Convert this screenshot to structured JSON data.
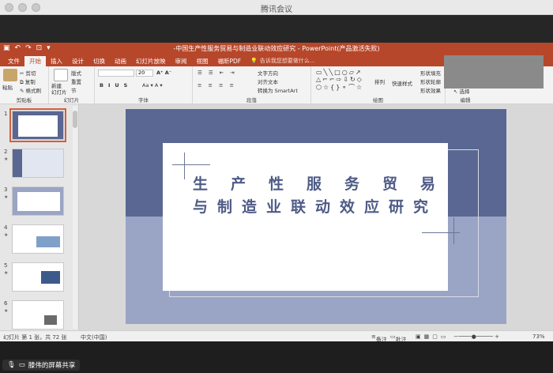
{
  "meeting": {
    "window_title": "腾讯会议",
    "share_label": "滕伟的屏幕共享"
  },
  "ppt": {
    "doc_title": "-中国生产性服务贸易与制造业联动效应研究 - PowerPoint(产品激活失败)",
    "tabs": [
      "文件",
      "开始",
      "插入",
      "设计",
      "切换",
      "动画",
      "幻灯片放映",
      "审阅",
      "视图",
      "福昕PDF"
    ],
    "active_tab": "开始",
    "tell_me": "告诉我您想要做什么...",
    "ribbon": {
      "paste": "粘贴",
      "cut": "剪切",
      "copy": "复制",
      "format_painter": "格式刷",
      "new_slide": "新建\n幻灯片",
      "layout": "版式",
      "reset": "重置",
      "section": "节",
      "font_size": "20",
      "text_direction": "文字方向",
      "align_text": "对齐文本",
      "convert_smartart": "转换为 SmartArt",
      "arrange": "排列",
      "quick_styles": "快速样式",
      "shape_fill": "形状填充",
      "shape_outline": "形状轮廓",
      "shape_effects": "形状效果",
      "select": "选择",
      "groups": {
        "clipboard": "剪贴板",
        "slides": "幻灯片",
        "font": "字体",
        "paragraph": "段落",
        "drawing": "绘图",
        "editing": "编辑"
      }
    },
    "thumb_numbers": [
      "1",
      "2",
      "3",
      "4",
      "5",
      "6"
    ],
    "slide": {
      "line1": "生产性服务贸易",
      "line2": "与制造业联动效应研究"
    },
    "status": {
      "slide_counter": "幻灯片 第 1 张，共 72 张",
      "language": "中文(中国)",
      "notes": "备注",
      "comments": "批注",
      "zoom": "73%"
    }
  },
  "colors": {
    "ppt_accent": "#b7472a",
    "slide_dark": "#5a6792",
    "slide_light": "#9aa4c5",
    "slide_text": "#4e5b86"
  }
}
